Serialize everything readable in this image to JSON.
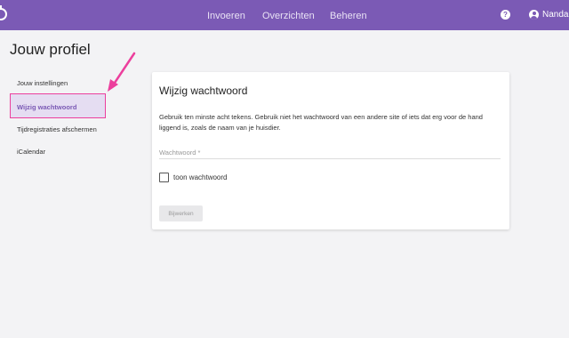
{
  "header": {
    "nav": [
      "Invoeren",
      "Overzichten",
      "Beheren"
    ],
    "help_label": "?",
    "user_name": "Nanda",
    "accent_color": "#7b5ab5"
  },
  "page_title": "Jouw profiel",
  "sidebar": {
    "items": [
      {
        "label": "Jouw instellingen"
      },
      {
        "label": "Wijzig wachtwoord",
        "active": true
      },
      {
        "label": "Tijdregistraties afschermen"
      },
      {
        "label": "iCalendar"
      }
    ],
    "highlight_color": "#ec3f9d"
  },
  "card": {
    "title": "Wijzig wachtwoord",
    "description": "Gebruik ten minste acht tekens. Gebruik niet het wachtwoord van een andere site of iets dat erg voor de hand liggend is, zoals de naam van je huisdier.",
    "password": {
      "value": "",
      "placeholder": "Wachtwoord *"
    },
    "show_password_label": "toon wachtwoord",
    "show_password_checked": false,
    "submit_label": "Bijwerken"
  }
}
